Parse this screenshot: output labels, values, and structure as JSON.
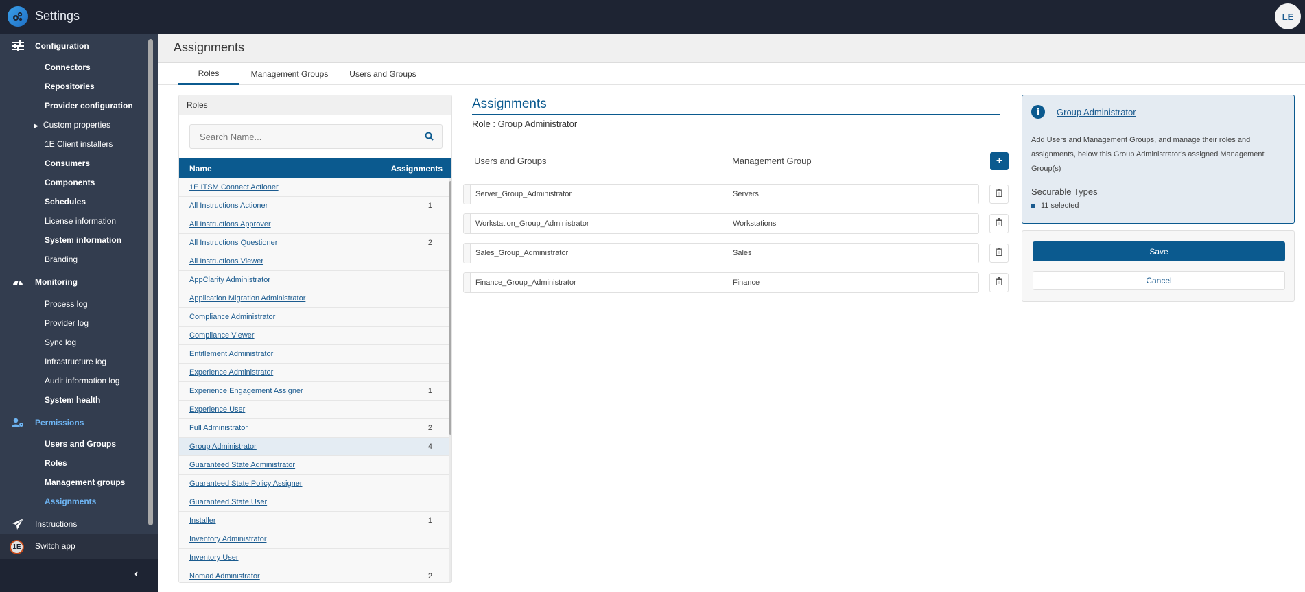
{
  "app": {
    "title": "Settings",
    "user_initials": "LE"
  },
  "sidebar": {
    "sections": [
      {
        "label": "Configuration",
        "icon": "sliders-icon"
      },
      {
        "label": "Monitoring",
        "icon": "gauge-icon"
      },
      {
        "label": "Permissions",
        "icon": "user-gear-icon"
      },
      {
        "label": "Instructions",
        "icon": "paper-plane-icon"
      }
    ],
    "configuration_items": [
      "Connectors",
      "Repositories",
      "Provider configuration",
      "Custom properties",
      "1E Client installers",
      "Consumers",
      "Components",
      "Schedules",
      "License information",
      "System information",
      "Branding"
    ],
    "monitoring_items": [
      "Process log",
      "Provider log",
      "Sync log",
      "Infrastructure log",
      "Audit information log",
      "System health"
    ],
    "permissions_items": [
      "Users and Groups",
      "Roles",
      "Management groups",
      "Assignments"
    ],
    "active_item": "Assignments",
    "switch_app": "Switch app"
  },
  "page": {
    "title": "Assignments",
    "tabs": [
      "Roles",
      "Management Groups",
      "Users and Groups"
    ],
    "active_tab": "Roles"
  },
  "roles": {
    "panel_title": "Roles",
    "search_placeholder": "Search Name...",
    "columns": [
      "Name",
      "Assignments"
    ],
    "rows": [
      {
        "name": "1E ITSM Connect Actioner",
        "count": ""
      },
      {
        "name": "All Instructions Actioner",
        "count": "1"
      },
      {
        "name": "All Instructions Approver",
        "count": ""
      },
      {
        "name": "All Instructions Questioner",
        "count": "2"
      },
      {
        "name": "All Instructions Viewer",
        "count": ""
      },
      {
        "name": "AppClarity Administrator",
        "count": ""
      },
      {
        "name": "Application Migration Administrator",
        "count": ""
      },
      {
        "name": "Compliance Administrator",
        "count": ""
      },
      {
        "name": "Compliance Viewer",
        "count": ""
      },
      {
        "name": "Entitlement Administrator",
        "count": ""
      },
      {
        "name": "Experience Administrator",
        "count": ""
      },
      {
        "name": "Experience Engagement Assigner",
        "count": "1"
      },
      {
        "name": "Experience User",
        "count": ""
      },
      {
        "name": "Full Administrator",
        "count": "2"
      },
      {
        "name": "Group Administrator",
        "count": "4"
      },
      {
        "name": "Guaranteed State Administrator",
        "count": ""
      },
      {
        "name": "Guaranteed State Policy Assigner",
        "count": ""
      },
      {
        "name": "Guaranteed State User",
        "count": ""
      },
      {
        "name": "Installer",
        "count": "1"
      },
      {
        "name": "Inventory Administrator",
        "count": ""
      },
      {
        "name": "Inventory User",
        "count": ""
      },
      {
        "name": "Nomad Administrator",
        "count": "2"
      }
    ],
    "selected": "Group Administrator"
  },
  "assignments": {
    "title": "Assignments",
    "role_line": "Role : Group Administrator",
    "col_users": "Users and Groups",
    "col_mg": "Management Group",
    "add_label": "+",
    "rows": [
      {
        "user_group": "Server_Group_Administrator",
        "management_group": "Servers"
      },
      {
        "user_group": "Workstation_Group_Administrator",
        "management_group": "Workstations"
      },
      {
        "user_group": "Sales_Group_Administrator",
        "management_group": "Sales"
      },
      {
        "user_group": "Finance_Group_Administrator",
        "management_group": "Finance"
      }
    ]
  },
  "info": {
    "title": "Group Administrator",
    "description": "Add Users and Management Groups, and manage their roles and assignments, below this Group Administrator's assigned Management Group(s)",
    "securable_heading": "Securable Types",
    "securable_value": "11 selected",
    "save_label": "Save",
    "cancel_label": "Cancel"
  },
  "colors": {
    "brand": "#0b5a8f",
    "sidebar": "#333d4f",
    "topbar": "#1e2433",
    "active_nav": "#6eb4f2"
  }
}
